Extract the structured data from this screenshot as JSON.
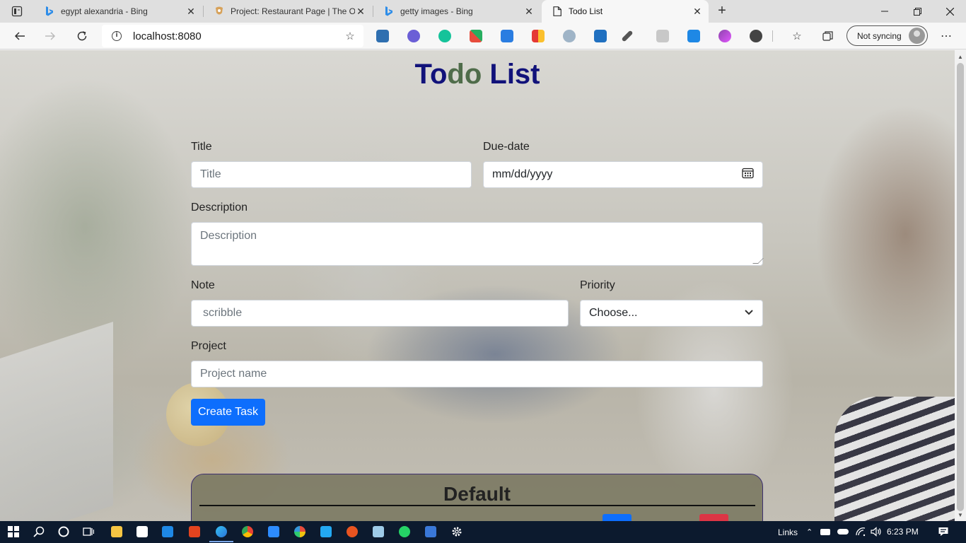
{
  "browser": {
    "tabs": [
      {
        "title": "egypt alexandria - Bing",
        "favicon": "bing-icon"
      },
      {
        "title": "Project: Restaurant Page | The Od",
        "favicon": "odin-project-icon"
      },
      {
        "title": "getty images - Bing",
        "favicon": "bing-icon"
      },
      {
        "title": "Todo List",
        "favicon": "page-icon"
      }
    ],
    "url": "localhost:8080",
    "profile_label": "Not syncing",
    "colors": {
      "bing": "#2e8de8",
      "tab_active": "#f7f7f7",
      "tabstrip": "#dfdfdf"
    }
  },
  "page": {
    "title_parts": [
      "To",
      "do",
      " List"
    ],
    "title_colors": [
      "#11127a",
      "#4f6c4a",
      "#11127a"
    ],
    "form": {
      "title_label": "Title",
      "title_placeholder": "Title",
      "due_label": "Due-date",
      "due_value": "mm/dd/yyyy",
      "description_label": "Description",
      "description_placeholder": "Description",
      "note_label": "Note",
      "note_placeholder": "scribble",
      "priority_label": "Priority",
      "priority_value": "Choose...",
      "project_label": "Project",
      "project_placeholder": "Project name",
      "submit_label": "Create Task"
    },
    "project_card": {
      "title": "Default",
      "colors": {
        "edit": "#0d6efd",
        "delete": "#dc3545"
      }
    }
  },
  "taskbar": {
    "links_label": "Links",
    "time": "6:23 PM"
  }
}
